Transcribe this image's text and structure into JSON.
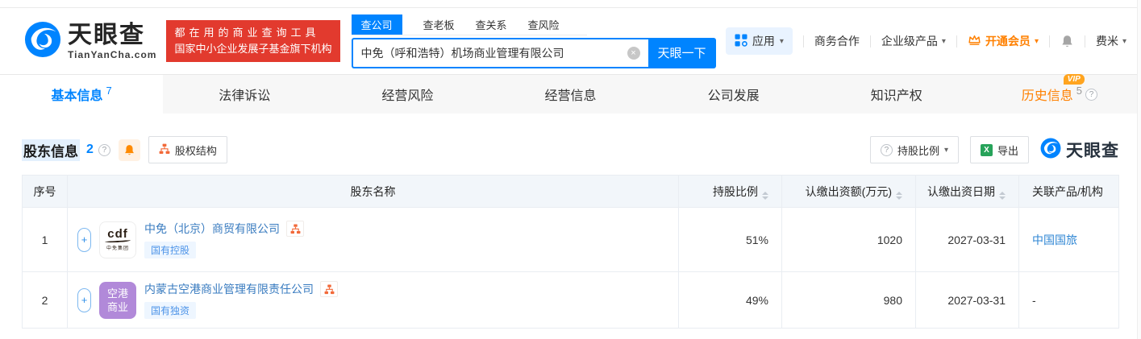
{
  "brand": {
    "name": "天眼查",
    "domain": "TianYanCha.com",
    "slogan_line1": "都在用的商业查询工具",
    "slogan_line2": "国家中小企业发展子基金旗下机构"
  },
  "search": {
    "tabs": [
      {
        "label": "查公司",
        "active": true
      },
      {
        "label": "查老板",
        "active": false
      },
      {
        "label": "查关系",
        "active": false
      },
      {
        "label": "查风险",
        "active": false
      }
    ],
    "value": "中免（呼和浩特）机场商业管理有限公司",
    "button": "天眼一下"
  },
  "top_nav": {
    "apps": "应用",
    "cooperation": "商务合作",
    "enterprise": "企业级产品",
    "vip": "开通会员",
    "user": "费米"
  },
  "page_tabs": [
    {
      "label": "基本信息",
      "count": "7"
    },
    {
      "label": "法律诉讼",
      "count": ""
    },
    {
      "label": "经营风险",
      "count": ""
    },
    {
      "label": "经营信息",
      "count": ""
    },
    {
      "label": "公司发展",
      "count": ""
    },
    {
      "label": "知识产权",
      "count": ""
    },
    {
      "label": "历史信息",
      "count": "5",
      "vip_badge": "VIP"
    }
  ],
  "section": {
    "title": "股东信息",
    "count": "2",
    "structure_button": "股权结构",
    "holding_button": "持股比例",
    "export_button": "导出",
    "watermark": "天眼查"
  },
  "table": {
    "headers": [
      {
        "label": "序号"
      },
      {
        "label": "股东名称"
      },
      {
        "label": "持股比例"
      },
      {
        "label": "认缴出资额(万元)"
      },
      {
        "label": "认缴出资日期"
      },
      {
        "label": "关联产品/机构"
      }
    ],
    "rows": [
      {
        "seq": "1",
        "name": "中免（北京）商贸有限公司",
        "tag": "国有控股",
        "logo_brand": "cdf",
        "logo_caption": "中免集团",
        "ratio": "51%",
        "amount": "1020",
        "date": "2027-03-31",
        "related": "中国国旅"
      },
      {
        "seq": "2",
        "name": "内蒙古空港商业管理有限责任公司",
        "tag": "国有独资",
        "logo_line1": "空港",
        "logo_line2": "商业",
        "ratio": "49%",
        "amount": "980",
        "date": "2027-03-31",
        "related": "-"
      }
    ]
  },
  "icons": {
    "caret": "▾",
    "plus": "+",
    "help": "?",
    "clear": "×",
    "excel_x": "X",
    "vip": "VIP"
  },
  "colors": {
    "primary_blue": "#0084ff",
    "banner_red": "#e23a2e",
    "orange": "#ff8000",
    "link_blue": "#3a7cc0",
    "tag_bg": "#eef6ff",
    "avatar_purple": "#b189d9"
  }
}
